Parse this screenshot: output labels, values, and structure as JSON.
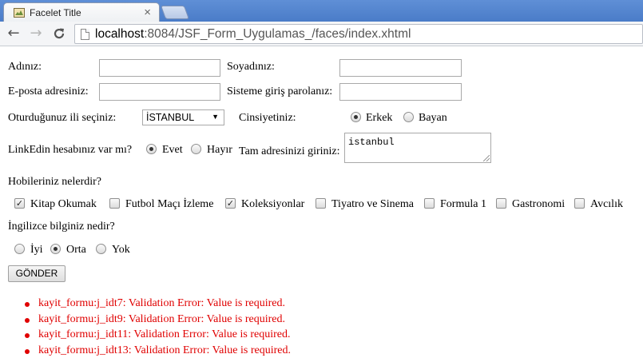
{
  "browser": {
    "tab_title": "Facelet Title",
    "tab_close": "×",
    "url_host": "localhost",
    "url_path": ":8084/JSF_Form_Uygulamas_/faces/index.xhtml",
    "back_icon": "←",
    "forward_icon": "→",
    "reload_icon": "C"
  },
  "form": {
    "name_label": "Adınız:",
    "name_value": "",
    "surname_label": "Soyadınız:",
    "surname_value": "",
    "email_label": "E-posta adresiniz:",
    "email_value": "",
    "password_label": "Sisteme giriş parolanız:",
    "password_value": "",
    "city_label": "Oturduğunuz ili seçiniz:",
    "city_selected": "İSTANBUL",
    "gender_label": "Cinsiyetiniz:",
    "gender_options": [
      "Erkek",
      "Bayan"
    ],
    "gender_selected": "Erkek",
    "linkedin_label": "LinkEdin hesabınız var mı?",
    "linkedin_options": [
      "Evet",
      "Hayır"
    ],
    "linkedin_selected": "Evet",
    "address_label": "Tam adresinizi giriniz:",
    "address_value": "istanbul",
    "hobbies_label": "Hobileriniz nelerdir?",
    "hobbies": [
      {
        "label": "Kitap Okumak",
        "checked": true
      },
      {
        "label": "Futbol Maçı İzleme",
        "checked": false
      },
      {
        "label": "Koleksiyonlar",
        "checked": true
      },
      {
        "label": "Tiyatro ve Sinema",
        "checked": false
      },
      {
        "label": "Formula 1",
        "checked": false
      },
      {
        "label": "Gastronomi",
        "checked": false
      },
      {
        "label": "Avcılık",
        "checked": false
      }
    ],
    "english_label": "İngilizce bilginiz nedir?",
    "english_options": [
      "İyi",
      "Orta",
      "Yok"
    ],
    "english_selected": "Orta",
    "submit_label": "GÖNDER"
  },
  "errors": [
    "kayit_formu:j_idt7: Validation Error: Value is required.",
    "kayit_formu:j_idt9: Validation Error: Value is required.",
    "kayit_formu:j_idt11: Validation Error: Value is required.",
    "kayit_formu:j_idt13: Validation Error: Value is required."
  ],
  "colors": {
    "error": "#e00000",
    "tabstrip": "#5f8fd6"
  }
}
